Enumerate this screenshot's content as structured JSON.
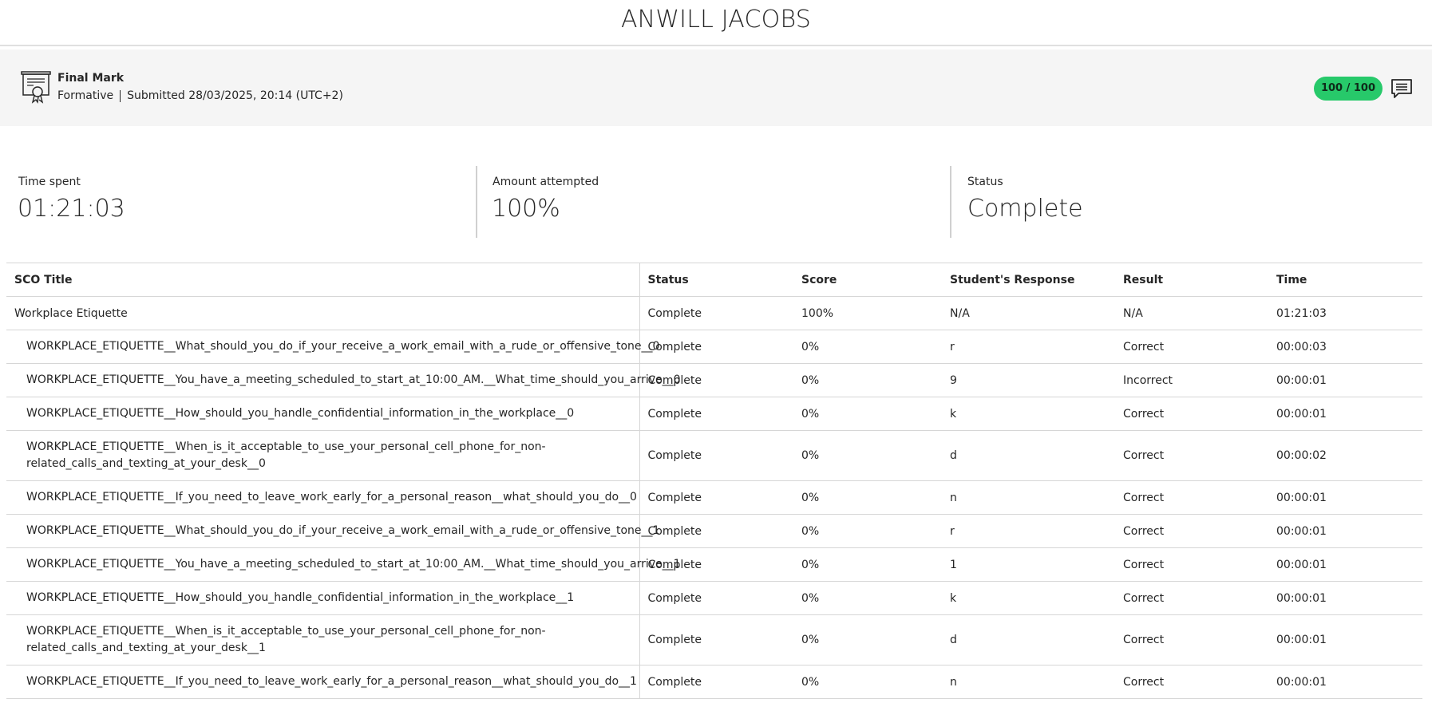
{
  "header": {
    "student_name": "ANWILL JACOBS"
  },
  "grade": {
    "title": "Final Mark",
    "type": "Formative",
    "submitted": "Submitted 28/03/2025, 20:14 (UTC+2)",
    "score_pill": "100 / 100",
    "pill_color": "#27c96a"
  },
  "stats": [
    {
      "label": "Time spent",
      "value": "01:21:03"
    },
    {
      "label": "Amount attempted",
      "value": "100%"
    },
    {
      "label": "Status",
      "value": "Complete"
    }
  ],
  "table": {
    "columns": [
      "SCO Title",
      "Status",
      "Score",
      "Student's Response",
      "Result",
      "Time"
    ],
    "rows": [
      {
        "title": "Workplace Etiquette",
        "status": "Complete",
        "score": "100%",
        "response": "N/A",
        "result": "N/A",
        "time": "01:21:03",
        "child": false,
        "tall": false
      },
      {
        "title": "WORKPLACE_ETIQUETTE__What_should_you_do_if_your_receive_a_work_email_with_a_rude_or_offensive_tone__0",
        "status": "Complete",
        "score": "0%",
        "response": "r",
        "result": "Correct",
        "time": "00:00:03",
        "child": true,
        "tall": false
      },
      {
        "title": "WORKPLACE_ETIQUETTE__You_have_a_meeting_scheduled_to_start_at_10:00_AM.__What_time_should_you_arrive__0",
        "status": "Complete",
        "score": "0%",
        "response": "9",
        "result": "Incorrect",
        "time": "00:00:01",
        "child": true,
        "tall": false
      },
      {
        "title": "WORKPLACE_ETIQUETTE__How_should_you_handle_confidential_information_in_the_workplace__0",
        "status": "Complete",
        "score": "0%",
        "response": "k",
        "result": "Correct",
        "time": "00:00:01",
        "child": true,
        "tall": false
      },
      {
        "title": "WORKPLACE_ETIQUETTE__When_is_it_acceptable_to_use_your_personal_cell_phone_for_non-related_calls_and_texting_at_your_desk__0",
        "status": "Complete",
        "score": "0%",
        "response": "d",
        "result": "Correct",
        "time": "00:00:02",
        "child": true,
        "tall": true
      },
      {
        "title": "WORKPLACE_ETIQUETTE__If_you_need_to_leave_work_early_for_a_personal_reason__what_should_you_do__0",
        "status": "Complete",
        "score": "0%",
        "response": "n",
        "result": "Correct",
        "time": "00:00:01",
        "child": true,
        "tall": false
      },
      {
        "title": "WORKPLACE_ETIQUETTE__What_should_you_do_if_your_receive_a_work_email_with_a_rude_or_offensive_tone__1",
        "status": "Complete",
        "score": "0%",
        "response": "r",
        "result": "Correct",
        "time": "00:00:01",
        "child": true,
        "tall": false
      },
      {
        "title": "WORKPLACE_ETIQUETTE__You_have_a_meeting_scheduled_to_start_at_10:00_AM.__What_time_should_you_arrive__1",
        "status": "Complete",
        "score": "0%",
        "response": "1",
        "result": "Correct",
        "time": "00:00:01",
        "child": true,
        "tall": false
      },
      {
        "title": "WORKPLACE_ETIQUETTE__How_should_you_handle_confidential_information_in_the_workplace__1",
        "status": "Complete",
        "score": "0%",
        "response": "k",
        "result": "Correct",
        "time": "00:00:01",
        "child": true,
        "tall": false
      },
      {
        "title": "WORKPLACE_ETIQUETTE__When_is_it_acceptable_to_use_your_personal_cell_phone_for_non-related_calls_and_texting_at_your_desk__1",
        "status": "Complete",
        "score": "0%",
        "response": "d",
        "result": "Correct",
        "time": "00:00:01",
        "child": true,
        "tall": true
      },
      {
        "title": "WORKPLACE_ETIQUETTE__If_you_need_to_leave_work_early_for_a_personal_reason__what_should_you_do__1",
        "status": "Complete",
        "score": "0%",
        "response": "n",
        "result": "Correct",
        "time": "00:00:01",
        "child": true,
        "tall": false
      }
    ]
  }
}
